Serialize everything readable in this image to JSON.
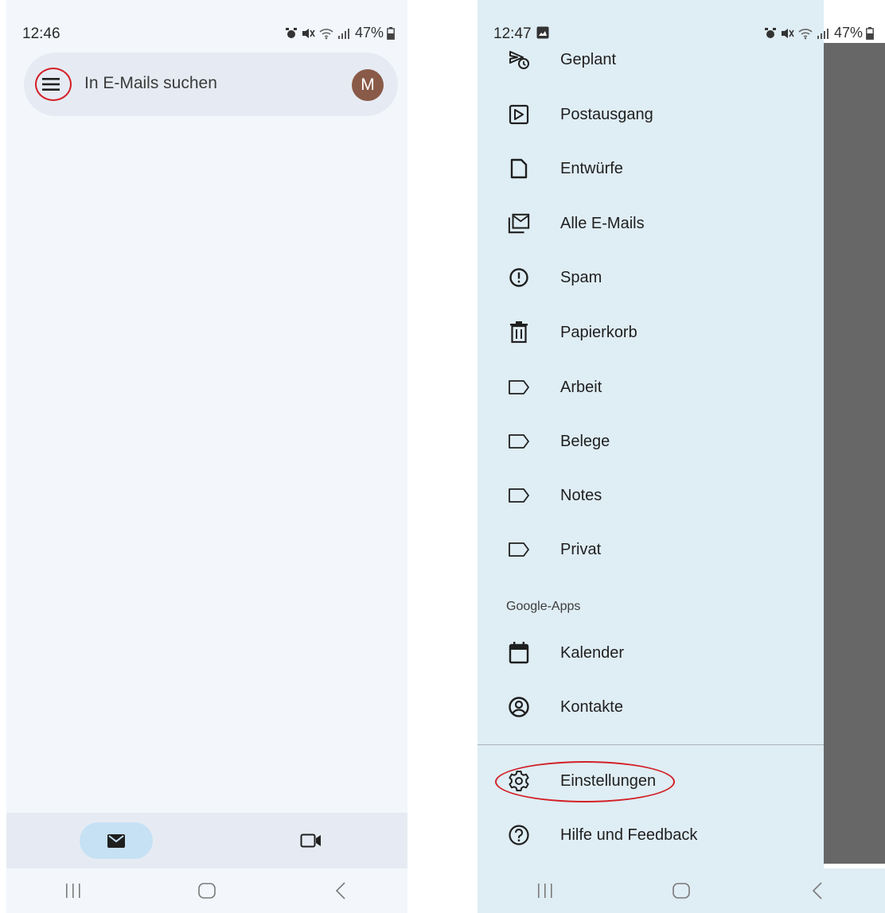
{
  "left": {
    "status": {
      "time": "12:46",
      "battery": "47%"
    },
    "search": {
      "placeholder": "In E-Mails suchen",
      "avatar_letter": "M"
    },
    "bottom_nav": [
      {
        "name": "mail",
        "icon": "mail-icon",
        "selected": true
      },
      {
        "name": "meet",
        "icon": "video-icon",
        "selected": false
      }
    ]
  },
  "right": {
    "status": {
      "time": "12:47",
      "battery": "47%"
    },
    "drawer_items": [
      {
        "label": "Geplant",
        "icon": "scheduled-send-icon"
      },
      {
        "label": "Postausgang",
        "icon": "outbox-icon"
      },
      {
        "label": "Entwürfe",
        "icon": "draft-icon"
      },
      {
        "label": "Alle E-Mails",
        "icon": "all-mail-icon"
      },
      {
        "label": "Spam",
        "icon": "spam-icon"
      },
      {
        "label": "Papierkorb",
        "icon": "trash-icon"
      },
      {
        "label": "Arbeit",
        "icon": "label-icon"
      },
      {
        "label": "Belege",
        "icon": "label-icon"
      },
      {
        "label": "Notes",
        "icon": "label-icon"
      },
      {
        "label": "Privat",
        "icon": "label-icon"
      }
    ],
    "google_apps_heading": "Google-Apps",
    "google_apps": [
      {
        "label": "Kalender",
        "icon": "calendar-icon"
      },
      {
        "label": "Kontakte",
        "icon": "contacts-icon"
      }
    ],
    "footer_items": [
      {
        "label": "Einstellungen",
        "icon": "settings-icon"
      },
      {
        "label": "Hilfe und Feedback",
        "icon": "help-icon"
      }
    ]
  },
  "colors": {
    "annotation": "#d32027",
    "drawer_bg": "#dfedf4",
    "scrim": "#676767",
    "avatar_bg": "#8a5a48",
    "selected_nav_pill": "#c6e1f4"
  }
}
